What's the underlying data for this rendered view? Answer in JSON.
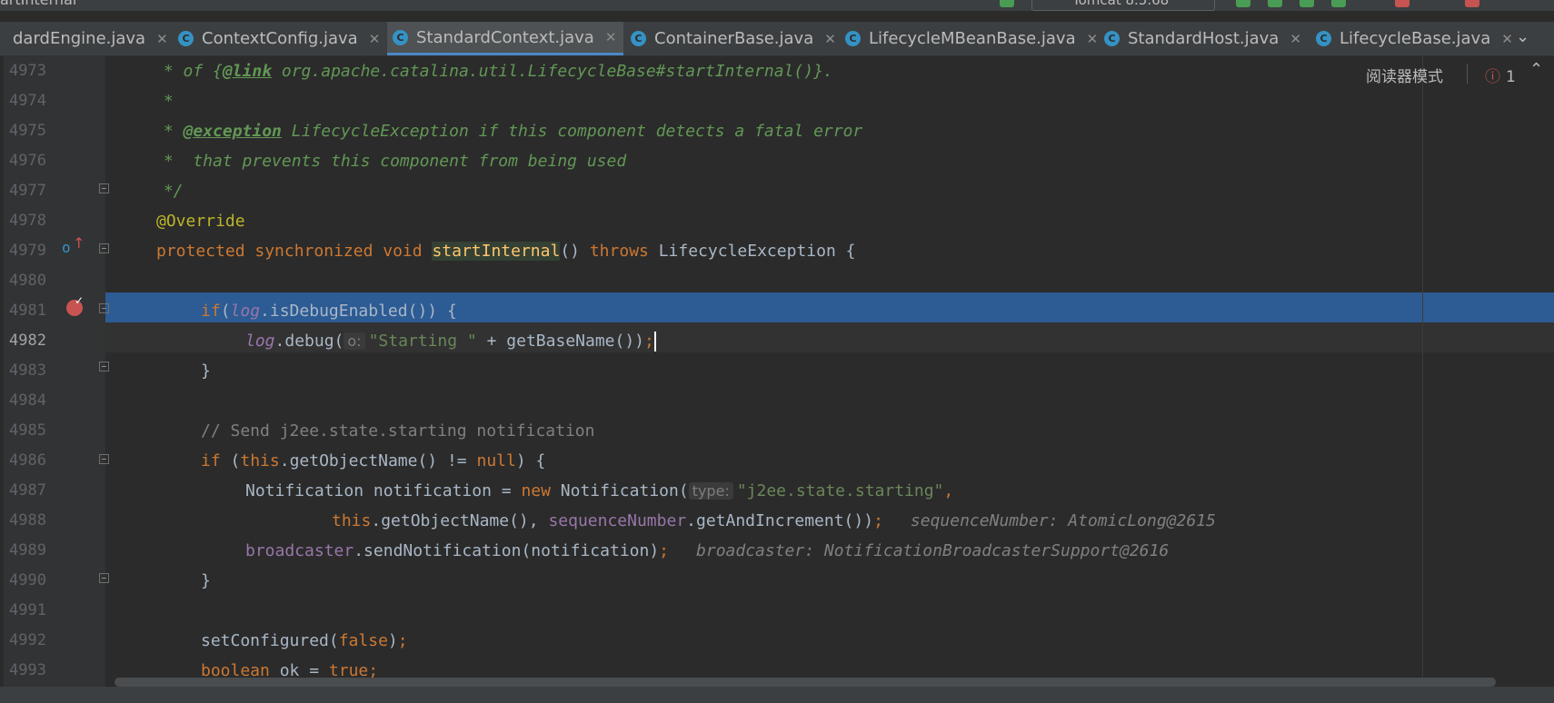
{
  "window": {
    "title_fragment": "artInternal",
    "run_config": "Tomcat 8.5.68"
  },
  "tabs": [
    {
      "label": "dardEngine.java",
      "active": false
    },
    {
      "label": "ContextConfig.java",
      "active": false
    },
    {
      "label": "StandardContext.java",
      "active": true
    },
    {
      "label": "ContainerBase.java",
      "active": false
    },
    {
      "label": "LifecycleMBeanBase.java",
      "active": false
    },
    {
      "label": "StandardHost.java",
      "active": false
    },
    {
      "label": "LifecycleBase.java",
      "active": false
    }
  ],
  "editor": {
    "reader_mode_label": "阅读器模式",
    "error_count": "1",
    "line_numbers": [
      "4973",
      "4974",
      "4975",
      "4976",
      "4977",
      "4978",
      "4979",
      "4980",
      "4981",
      "4982",
      "4983",
      "4984",
      "4985",
      "4986",
      "4987",
      "4988",
      "4989",
      "4990",
      "4991",
      "4992",
      "4993"
    ],
    "current_line": "4982",
    "breakpoint_line": "4981",
    "code": {
      "l4973": {
        "star": " * of {",
        "tag": "@link",
        "rest": " org.apache.catalina.util.LifecycleBase#startInternal()}."
      },
      "l4974": " *",
      "l4975": {
        "star": " * ",
        "tag": "@exception",
        "rest": " LifecycleException if this component detects a fatal error"
      },
      "l4976": " *  that prevents this component from being used",
      "l4977": " */",
      "l4978": "@Override",
      "l4979": {
        "kw": "protected synchronized void ",
        "fn": "startInternal",
        "mid": "() ",
        "kw2": "throws",
        "rest": " LifecycleException {"
      },
      "l4981": {
        "kw": "if",
        "p1": "(",
        "log": "log",
        "rest": ".isDebugEnabled()) {"
      },
      "l4982": {
        "log": "log",
        "p1": ".debug(",
        "hint": "o:",
        "str": "\"Starting \"",
        "rest": " + getBaseName())",
        "semi": ";"
      },
      "l4983": "}",
      "l4985": "// Send j2ee.state.starting notification",
      "l4986": {
        "kw": "if",
        "p1": " (",
        "kw2": "this",
        "mid": ".getObjectName() != ",
        "kw3": "null",
        "rest": ") {"
      },
      "l4987": {
        "p1": "Notification notification = ",
        "kw": "new",
        "p2": " Notification(",
        "hint": "type:",
        "str": "\"j2ee.state.starting\"",
        "comma": ","
      },
      "l4988": {
        "kw": "this",
        "p1": ".getObjectName(), ",
        "field": "sequenceNumber",
        "p2": ".getAndIncrement())",
        "semi": ";",
        "inline": "sequenceNumber: AtomicLong@2615"
      },
      "l4989": {
        "field": "broadcaster",
        "p1": ".sendNotification(notification)",
        "semi": ";",
        "inline": "broadcaster: NotificationBroadcasterSupport@2616"
      },
      "l4990": "}",
      "l4992": {
        "p1": "setConfigured(",
        "kw": "false",
        "p2": ")",
        "semi": ";"
      },
      "l4993": {
        "kw": "boolean",
        "p1": " ok = ",
        "kw2": "true",
        "semi": ";"
      }
    }
  },
  "colors": {
    "background": "#2b2b2b",
    "selection": "#2d5b94",
    "keyword": "#cc7832",
    "comment": "#629755",
    "string": "#6a8759",
    "field": "#9876aa"
  }
}
